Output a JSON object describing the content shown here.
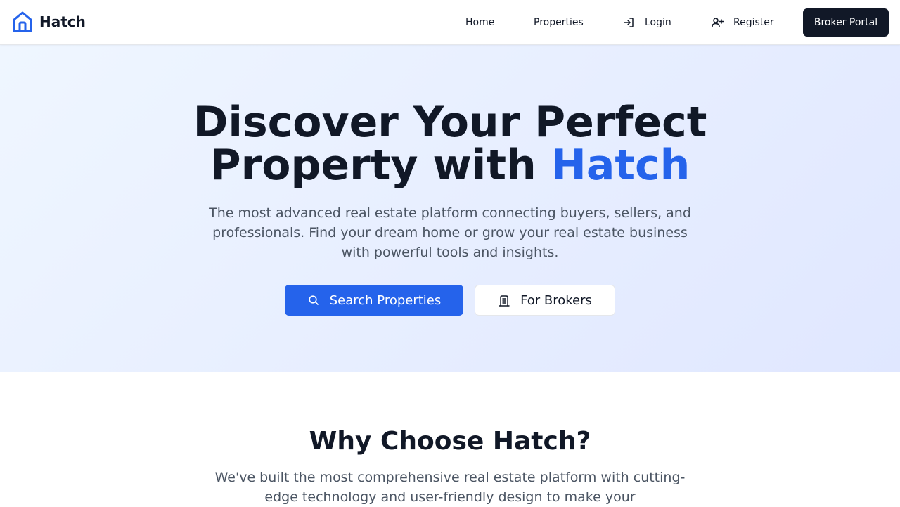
{
  "brand": {
    "name": "Hatch",
    "icon": "house-icon",
    "color": "#2563eb"
  },
  "nav": {
    "home": "Home",
    "properties": "Properties",
    "login": "Login",
    "login_icon": "log-in-icon",
    "register": "Register",
    "register_icon": "user-plus-icon",
    "broker_portal": "Broker Portal"
  },
  "hero": {
    "title_line1": "Discover Your Perfect",
    "title_line2_prefix": "Property with ",
    "title_accent": "Hatch",
    "subtitle": "The most advanced real estate platform connecting buyers, sellers, and professionals. Find your dream home or grow your real estate business with powerful tools and insights.",
    "primary_button": "Search Properties",
    "primary_icon": "search-icon",
    "secondary_button": "For Brokers",
    "secondary_icon": "building-icon"
  },
  "why": {
    "title": "Why Choose Hatch?",
    "subtitle": "We've built the most comprehensive real estate platform with cutting-edge technology and user-friendly design to make your"
  },
  "colors": {
    "accent": "#2563eb",
    "dark": "#111827",
    "muted_text": "#4b5563",
    "hero_gradient_start": "#eff6ff",
    "hero_gradient_end": "#e0e7ff"
  }
}
